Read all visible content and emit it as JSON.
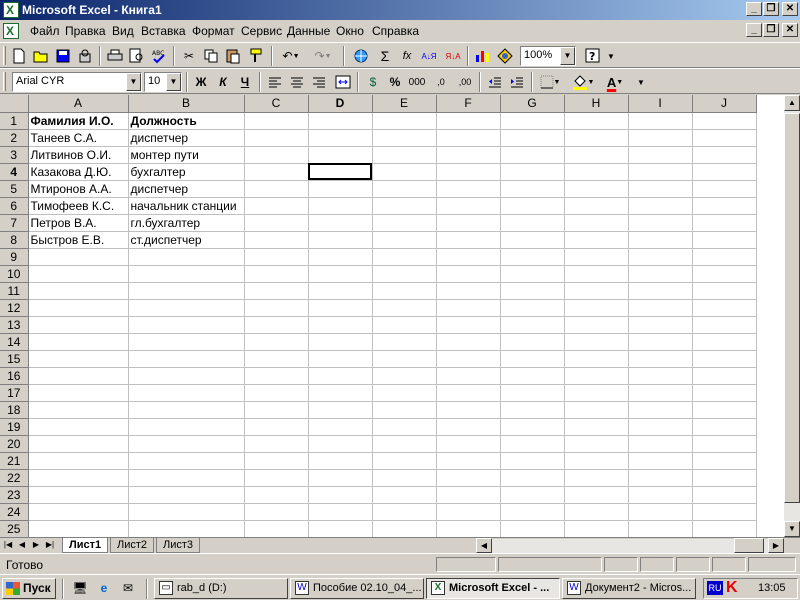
{
  "window": {
    "title": "Microsoft Excel - Книга1",
    "controls": [
      "_",
      "❐",
      "✕"
    ]
  },
  "menu": {
    "items": [
      "Файл",
      "Правка",
      "Вид",
      "Вставка",
      "Формат",
      "Сервис",
      "Данные",
      "Окно",
      "Справка"
    ],
    "doc_controls": [
      "_",
      "❐",
      "✕"
    ]
  },
  "toolbar_standard": {
    "icons": [
      "new-icon",
      "open-icon",
      "save-icon",
      "permission-icon",
      "print-icon",
      "print-preview-icon",
      "spelling-icon",
      "cut-icon",
      "copy-icon",
      "paste-icon",
      "format-painter-icon",
      "undo-icon",
      "redo-icon",
      "hyperlink-icon",
      "autosum-icon",
      "function-icon",
      "sort-ascending-icon",
      "sort-descending-icon",
      "chart-wizard-icon",
      "drawing-icon",
      "help-icon"
    ],
    "glyphs": {
      "autosum": "Σ",
      "function": "fx",
      "sort_asc": "А↓Я",
      "sort_desc": "Я↓А"
    },
    "zoom": "100%"
  },
  "toolbar_formatting": {
    "font_name": "Arial CYR",
    "font_size": "10",
    "bold": "Ж",
    "italic": "К",
    "underline": "Ч",
    "currency": "$",
    "percent": "%",
    "thousands": "000",
    "inc_decimal": ",0",
    "dec_decimal": ",00",
    "font_color_glyph": "A",
    "accent_fill": "#ffff00",
    "accent_font": "#ff0000"
  },
  "sheet": {
    "columns": [
      "A",
      "B",
      "C",
      "D",
      "E",
      "F",
      "G",
      "H",
      "I",
      "J"
    ],
    "active_column": "D",
    "active_row": "4",
    "row_count": 25,
    "rows": [
      [
        "Фамилия И.О.",
        "Должность"
      ],
      [
        "Танеев С.А.",
        "диспетчер"
      ],
      [
        "Литвинов О.И.",
        "монтер пути"
      ],
      [
        "Казакова Д.Ю.",
        "бухгалтер"
      ],
      [
        "Мтиронов А.А.",
        "диспетчер"
      ],
      [
        "Тимофеев К.С.",
        "начальник станции"
      ],
      [
        "Петров В.А.",
        "гл.бухгалтер"
      ],
      [
        "Быстров Е.В.",
        "ст.диспетчер"
      ]
    ]
  },
  "sheet_tabs": [
    "Лист1",
    "Лист2",
    "Лист3"
  ],
  "status": {
    "text": "Готово"
  },
  "taskbar": {
    "start": "Пуск",
    "tasks": [
      {
        "label": "rab_d (D:)",
        "icon": "drive-icon"
      },
      {
        "label": "Пособие 02.10_04_...",
        "icon": "word-icon"
      },
      {
        "label": "Microsoft Excel - ...",
        "icon": "excel-icon"
      },
      {
        "label": "Документ2 - Micros...",
        "icon": "word-icon"
      }
    ],
    "lang": "RU",
    "clock": "13:05"
  }
}
